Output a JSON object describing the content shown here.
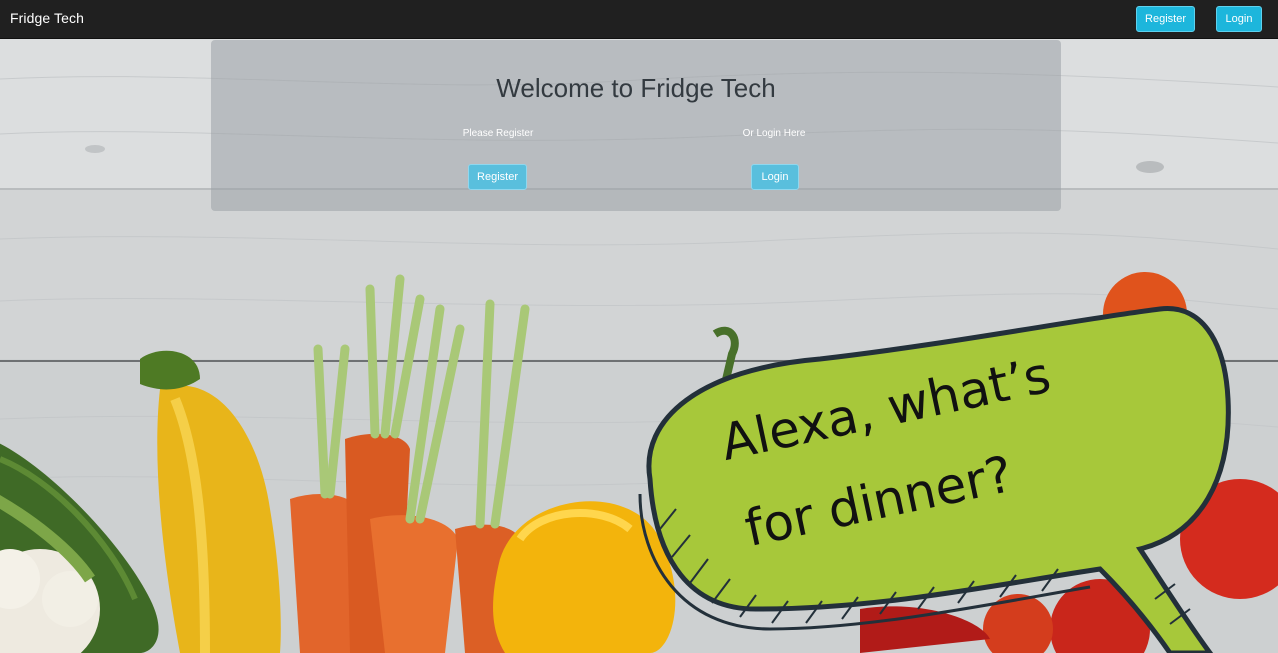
{
  "navbar": {
    "brand": "Fridge Tech",
    "register_label": "Register",
    "login_label": "Login"
  },
  "welcome_panel": {
    "title": "Welcome to Fridge Tech",
    "register_prompt": "Please Register",
    "login_prompt": "Or Login Here",
    "register_button": "Register",
    "login_button": "Login"
  },
  "hero_image": {
    "speech_bubble_line1": "Alexa, what’s",
    "speech_bubble_line2": "for dinner?"
  },
  "colors": {
    "navbar_bg": "#202020",
    "accent": "#1db6dc",
    "panel_button": "#59bfdd",
    "bubble_green": "#a7c83a"
  }
}
